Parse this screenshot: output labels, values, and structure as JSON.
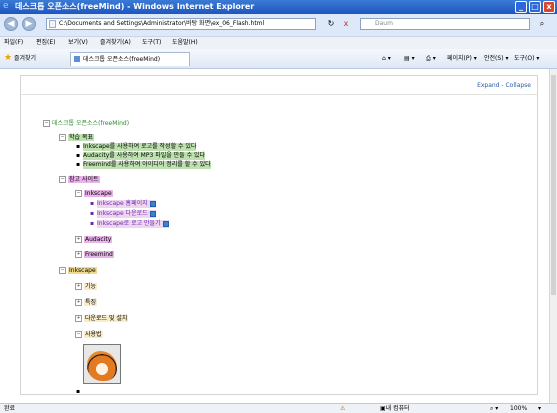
{
  "window": {
    "title": "데스크톱 오픈소스(freeMind) - Windows Internet Explorer",
    "min": "_",
    "max": "□",
    "close": "x"
  },
  "address": {
    "url": "C:\\Documents and Settings\\Administrator\\바탕 화면\\ex_06_Flash.html",
    "search_placeholder": "Daum",
    "back": "◀",
    "forward": "▶",
    "refresh": "↻",
    "stop": "x"
  },
  "menu": [
    "파일(F)",
    "편집(E)",
    "보기(V)",
    "즐겨찾기(A)",
    "도구(T)",
    "도움말(H)"
  ],
  "favorites": {
    "label": "즐겨찾기",
    "tab_title": "데스크톱 오픈소스(freeMind)",
    "commands": [
      "페이지(P) ▾",
      "안전(S) ▾",
      "도구(O) ▾"
    ]
  },
  "content": {
    "expand_collapse": "Expand - Collapse",
    "root": "데스크톱 오픈소스(freeMind)",
    "section1": {
      "title": "학습 목표",
      "items": [
        "Inkscape를 사용하여 로고를 작성할 수 있다",
        "Audacity를 사용하여 MP3 파일을 만들 수 있다",
        "Freemind를 사용하여 아이디어 정리를 할 수 있다"
      ]
    },
    "section2": {
      "title": "참고 사이트",
      "inkscape": "Inkscape",
      "links": [
        "Inkscape 홈페이지",
        "Inkscape 다운로드",
        "Inkscape로 로고 만들기"
      ],
      "audacity": "Audacity",
      "freemind": "Freemind"
    },
    "section3": {
      "title": "Inkscape",
      "children": [
        "기능",
        "특징",
        "다운로드 및 설치",
        "사용법"
      ]
    }
  },
  "status": {
    "left": "완료",
    "zone": "내 컴퓨터",
    "zoom": "100%"
  },
  "colors": {
    "section1_bg": "#bfe0b0",
    "section2_bg": "#e8b3e8",
    "inkscape_bg": "#f1d98e",
    "link_color": "#6a2bb0",
    "green_text": "#2f8a2f"
  }
}
